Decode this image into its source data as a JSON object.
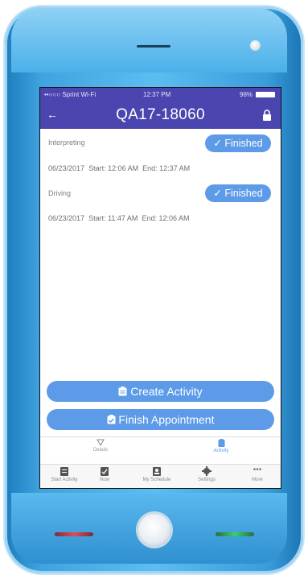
{
  "status_bar": {
    "carrier": "••○○○ Sprint Wi-Fi",
    "time": "12:37 PM",
    "battery": "98%"
  },
  "header": {
    "back_glyph": "←",
    "title": "QA17-18060"
  },
  "activities": [
    {
      "label": "Interpreting",
      "status": "✓ Finished",
      "date": "06/23/2017",
      "start": "Start: 12:06 AM",
      "end": "End: 12:37 AM"
    },
    {
      "label": "Driving",
      "status": "✓ Finished",
      "date": "06/23/2017",
      "start": "Start: 11:47 AM",
      "end": "End: 12:06 AM"
    }
  ],
  "actions": {
    "create_activity": "Create Activity",
    "finish_appointment": "Finish Appointment"
  },
  "subtabs": [
    {
      "label": "Details",
      "icon": "triangle-down-icon"
    },
    {
      "label": "Activity",
      "icon": "clipboard-icon"
    }
  ],
  "tabbar": [
    {
      "label": "Start Activity",
      "icon": "clipboard-icon"
    },
    {
      "label": "Now",
      "icon": "check-clipboard-icon"
    },
    {
      "label": "My Schedule",
      "icon": "contact-card-icon"
    },
    {
      "label": "Settings",
      "icon": "gear-icon"
    },
    {
      "label": "More",
      "icon": "more-icon"
    }
  ],
  "colors": {
    "primary": "#4b45b0",
    "button": "#5d9be8",
    "phone_body": "#3fa3df"
  }
}
